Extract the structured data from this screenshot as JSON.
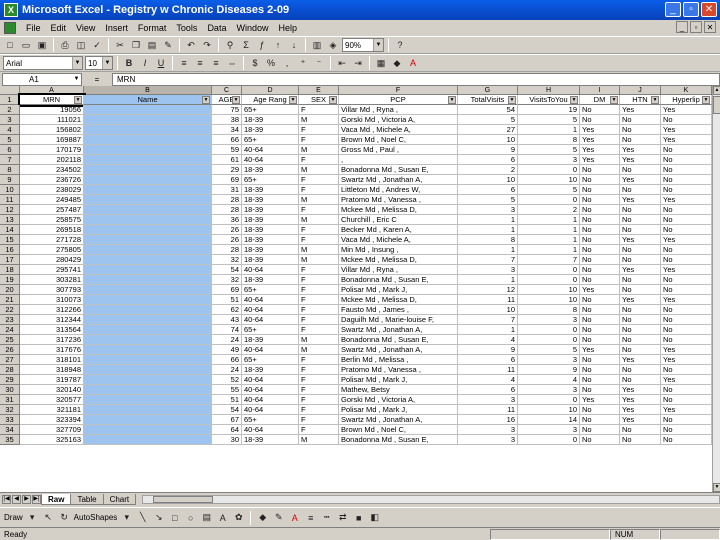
{
  "window": {
    "title": "Microsoft Excel - Registry w Chronic Diseases 2-09",
    "app_icon": "X"
  },
  "menu": [
    "File",
    "Edit",
    "View",
    "Insert",
    "Format",
    "Tools",
    "Data",
    "Window",
    "Help"
  ],
  "toolbar_standard": {
    "zoom": "90%"
  },
  "toolbar_format": {
    "font": "Arial",
    "size": "10"
  },
  "formula_bar": {
    "name_box": "A1",
    "fx": "=",
    "value": "MRN"
  },
  "columns": [
    "A",
    "B",
    "C",
    "D",
    "E",
    "F",
    "G",
    "H",
    "I",
    "J",
    "K"
  ],
  "header_row": [
    "MRN",
    "Name",
    "AGE",
    "Age Rang",
    "SEX",
    "PCP",
    "TotalVisits",
    "VisitsToYou",
    "DM",
    "HTN",
    "Hyperlip"
  ],
  "rows": [
    [
      "2",
      "19056",
      "",
      "75",
      "65+",
      "F",
      "Villar Md , Ryna ,",
      "54",
      "19",
      "No",
      "Yes",
      "Yes"
    ],
    [
      "3",
      "111021",
      "",
      "38",
      "18-39",
      "M",
      "Gorski Md , Victoria A,",
      "5",
      "5",
      "No",
      "No",
      "No"
    ],
    [
      "4",
      "156802",
      "",
      "34",
      "18-39",
      "F",
      "Vaca Md , Michele A,",
      "27",
      "1",
      "Yes",
      "No",
      "Yes"
    ],
    [
      "5",
      "169887",
      "",
      "66",
      "65+",
      "F",
      "Brown Md , Noel C,",
      "10",
      "8",
      "Yes",
      "No",
      "Yes"
    ],
    [
      "6",
      "170179",
      "",
      "59",
      "40-64",
      "M",
      "Gross Md , Paul ,",
      "9",
      "5",
      "Yes",
      "Yes",
      "No"
    ],
    [
      "7",
      "202118",
      "",
      "61",
      "40-64",
      "F",
      ",",
      "6",
      "3",
      "Yes",
      "Yes",
      "No"
    ],
    [
      "8",
      "234502",
      "",
      "29",
      "18-39",
      "M",
      "Bonadonna Md , Susan E,",
      "2",
      "0",
      "No",
      "No",
      "No"
    ],
    [
      "9",
      "236726",
      "",
      "69",
      "65+",
      "F",
      "Swartz Md , Jonathan A,",
      "10",
      "10",
      "No",
      "Yes",
      "No"
    ],
    [
      "10",
      "238029",
      "",
      "31",
      "18-39",
      "F",
      "Littleton Md , Andres W,",
      "6",
      "5",
      "No",
      "No",
      "No"
    ],
    [
      "11",
      "249485",
      "",
      "28",
      "18-39",
      "M",
      "Pratomo Md , Vanessa ,",
      "5",
      "0",
      "No",
      "Yes",
      "Yes"
    ],
    [
      "12",
      "257487",
      "",
      "28",
      "18-39",
      "F",
      "Mckee Md , Melissa D,",
      "3",
      "2",
      "No",
      "No",
      "No"
    ],
    [
      "13",
      "258575",
      "",
      "36",
      "18-39",
      "M",
      "Churchill , Eric C",
      "1",
      "1",
      "No",
      "No",
      "No"
    ],
    [
      "14",
      "269518",
      "",
      "26",
      "18-39",
      "F",
      "Becker Md , Karen A,",
      "1",
      "1",
      "No",
      "No",
      "No"
    ],
    [
      "15",
      "271728",
      "",
      "26",
      "18-39",
      "F",
      "Vaca Md , Michele A,",
      "8",
      "1",
      "No",
      "Yes",
      "Yes"
    ],
    [
      "16",
      "275805",
      "",
      "28",
      "18-39",
      "M",
      "Min Md , Insung ,",
      "1",
      "1",
      "No",
      "No",
      "No"
    ],
    [
      "17",
      "280429",
      "",
      "32",
      "18-39",
      "M",
      "Mckee Md , Melissa D,",
      "7",
      "7",
      "No",
      "No",
      "No"
    ],
    [
      "18",
      "295741",
      "",
      "54",
      "40-64",
      "F",
      "Villar Md , Ryna ,",
      "3",
      "0",
      "No",
      "Yes",
      "Yes"
    ],
    [
      "19",
      "303281",
      "",
      "32",
      "18-39",
      "F",
      "Bonadonna Md , Susan E,",
      "1",
      "0",
      "No",
      "No",
      "No"
    ],
    [
      "20",
      "307793",
      "",
      "69",
      "65+",
      "F",
      "Polisar Md , Mark J,",
      "12",
      "10",
      "Yes",
      "No",
      "No"
    ],
    [
      "21",
      "310073",
      "",
      "51",
      "40-64",
      "F",
      "Mckee Md , Melissa D,",
      "11",
      "10",
      "No",
      "Yes",
      "Yes"
    ],
    [
      "22",
      "312266",
      "",
      "62",
      "40-64",
      "F",
      "Fausto Md , James ,",
      "10",
      "8",
      "No",
      "No",
      "No"
    ],
    [
      "23",
      "312344",
      "",
      "43",
      "40-64",
      "F",
      "Daguilh Md , Marie-louise F,",
      "7",
      "3",
      "No",
      "No",
      "No"
    ],
    [
      "24",
      "313564",
      "",
      "74",
      "65+",
      "F",
      "Swartz Md , Jonathan A,",
      "1",
      "0",
      "No",
      "No",
      "No"
    ],
    [
      "25",
      "317236",
      "",
      "24",
      "18-39",
      "M",
      "Bonadonna Md , Susan E,",
      "4",
      "0",
      "No",
      "No",
      "No"
    ],
    [
      "26",
      "317676",
      "",
      "49",
      "40-64",
      "M",
      "Swartz Md , Jonathan A,",
      "9",
      "5",
      "Yes",
      "No",
      "Yes"
    ],
    [
      "27",
      "318101",
      "",
      "66",
      "65+",
      "F",
      "Berlin Md , Melissa ,",
      "6",
      "3",
      "No",
      "Yes",
      "Yes"
    ],
    [
      "28",
      "318948",
      "",
      "24",
      "18-39",
      "F",
      "Pratomo Md , Vanessa ,",
      "11",
      "9",
      "No",
      "No",
      "No"
    ],
    [
      "29",
      "319787",
      "",
      "52",
      "40-64",
      "F",
      "Polisar Md , Mark J,",
      "4",
      "4",
      "No",
      "No",
      "Yes"
    ],
    [
      "30",
      "320140",
      "",
      "55",
      "40-64",
      "F",
      "Mathew, Betsy",
      "6",
      "3",
      "No",
      "Yes",
      "No"
    ],
    [
      "31",
      "320577",
      "",
      "51",
      "40-64",
      "F",
      "Gorski Md , Victoria A,",
      "3",
      "0",
      "Yes",
      "Yes",
      "No"
    ],
    [
      "32",
      "321181",
      "",
      "54",
      "40-64",
      "F",
      "Polisar Md , Mark J,",
      "11",
      "10",
      "No",
      "Yes",
      "Yes"
    ],
    [
      "33",
      "323394",
      "",
      "67",
      "65+",
      "F",
      "Swartz Md , Jonathan A,",
      "16",
      "14",
      "No",
      "Yes",
      "No"
    ],
    [
      "34",
      "327709",
      "",
      "64",
      "40-64",
      "F",
      "Brown Md , Noel C,",
      "3",
      "3",
      "No",
      "No",
      "No"
    ],
    [
      "35",
      "325163",
      "",
      "30",
      "18-39",
      "M",
      "Bonadonna Md , Susan E,",
      "3",
      "0",
      "No",
      "No",
      "No"
    ]
  ],
  "sheet_tabs": [
    "Raw",
    "Table",
    "Chart"
  ],
  "active_tab": "Raw",
  "draw_toolbar": {
    "draw": "Draw",
    "autoshapes": "AutoShapes"
  },
  "status": {
    "ready": "Ready",
    "num": "NUM"
  },
  "colors": {
    "selected_column": "#9dc3ef",
    "title_bar": "#0a5ee8"
  }
}
